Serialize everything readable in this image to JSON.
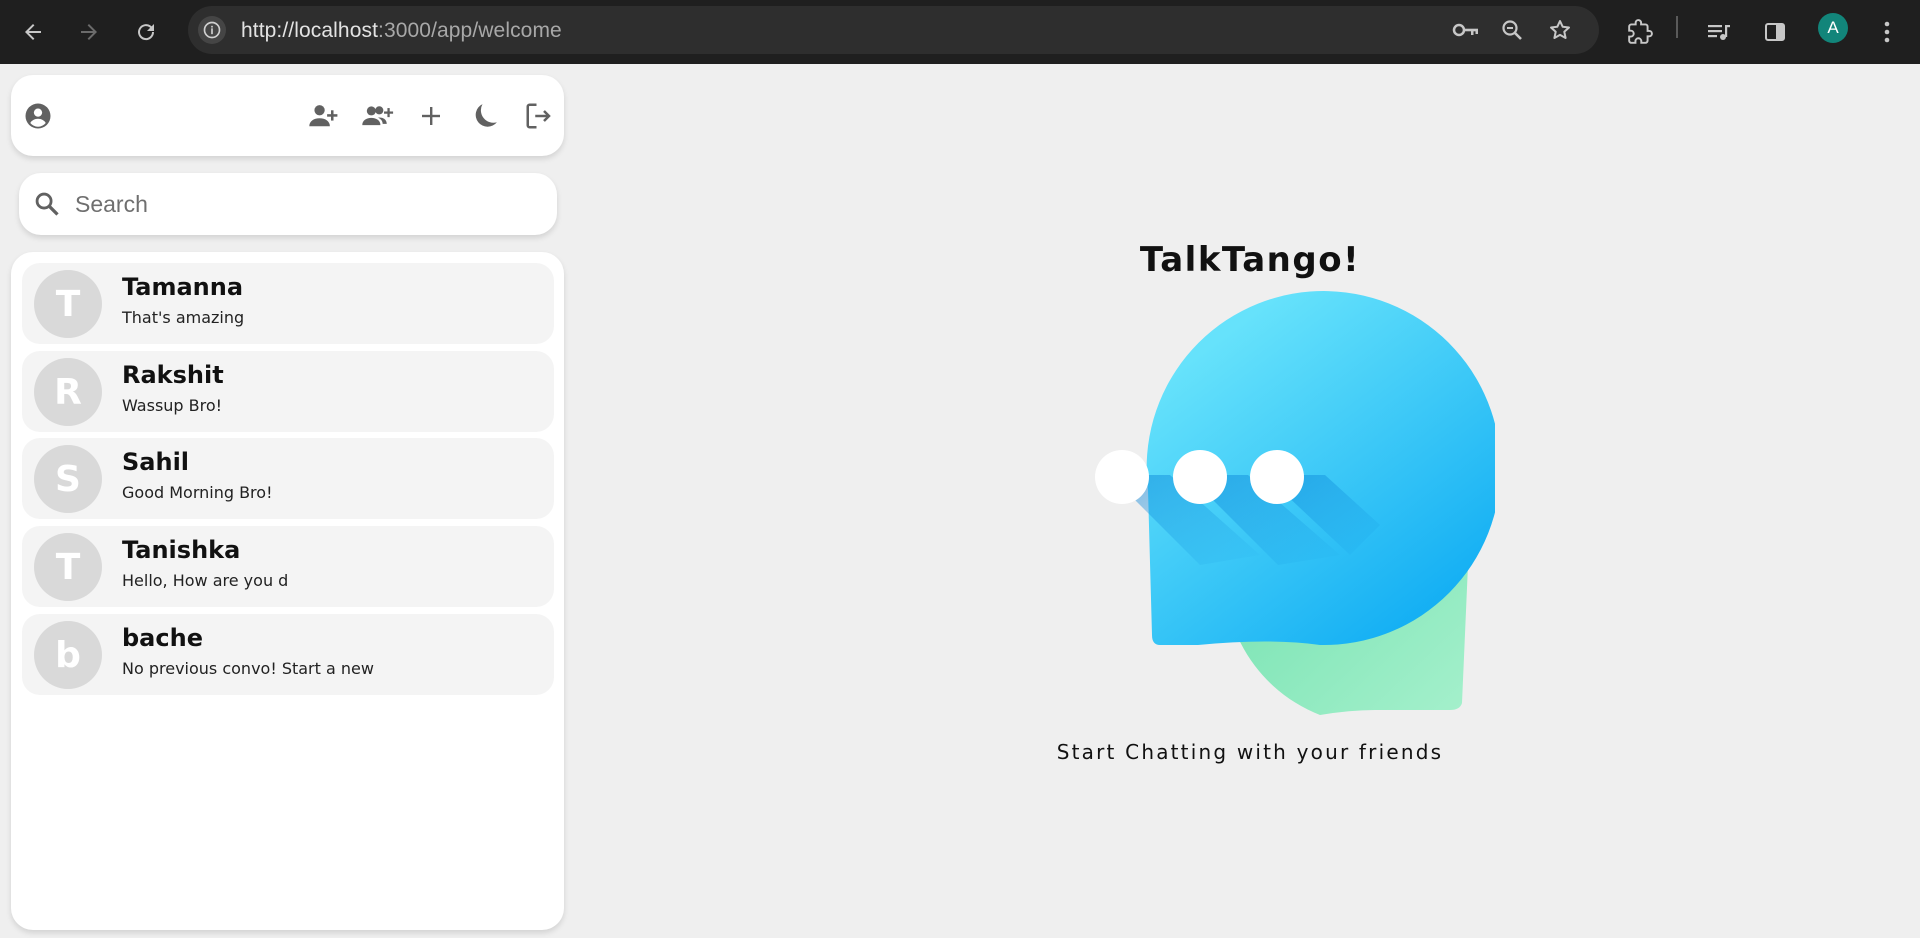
{
  "browser": {
    "url_host": "http://localhost",
    "url_rest": ":3000/app/welcome",
    "profile_initial": "A",
    "colors": {
      "chrome_bg": "#1f1f1f",
      "omnibox_bg": "#2e2e2e",
      "profile_bg": "#12857a"
    },
    "icons": [
      "back-icon",
      "forward-icon",
      "reload-icon",
      "site-info-icon",
      "password-key-icon",
      "zoom-icon",
      "bookmark-star-icon",
      "extensions-icon",
      "media-queue-icon",
      "side-panel-icon",
      "menu-kebab-icon"
    ]
  },
  "sidebar": {
    "topbar_icons": [
      "account-circle-icon",
      "add-user-icon",
      "add-group-icon",
      "plus-icon",
      "dark-mode-icon",
      "logout-icon"
    ],
    "search": {
      "placeholder": "Search",
      "value": ""
    },
    "conversations": [
      {
        "initial": "T",
        "name": "Tamanna",
        "last_message": "That's amazing"
      },
      {
        "initial": "R",
        "name": "Rakshit",
        "last_message": "Wassup Bro!"
      },
      {
        "initial": "S",
        "name": "Sahil",
        "last_message": "Good Morning Bro!"
      },
      {
        "initial": "T",
        "name": "Tanishka",
        "last_message": "Hello, How are you d"
      },
      {
        "initial": "b",
        "name": "bache",
        "last_message": "No previous convo! Start a new"
      }
    ]
  },
  "welcome": {
    "title": "TalkTango!",
    "subtitle": "Start Chatting with your friends",
    "colors": {
      "bubble_blue": "#33c6f5",
      "bubble_green": "#7de6b3",
      "background": "#efefef"
    }
  }
}
